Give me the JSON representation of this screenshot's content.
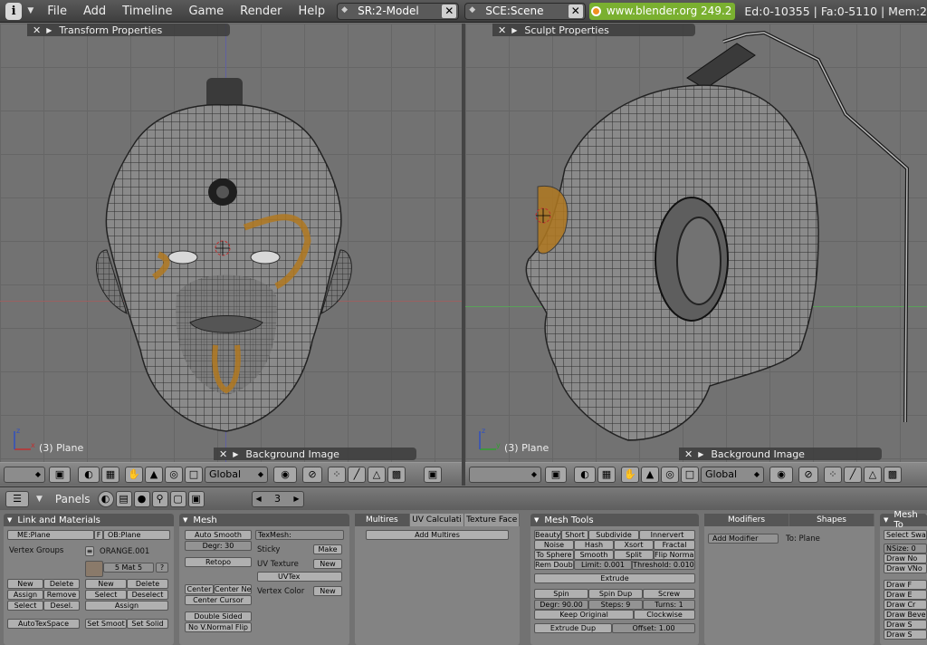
{
  "menu": {
    "items": [
      "File",
      "Add",
      "Timeline",
      "Game",
      "Render",
      "Help"
    ],
    "screen": "SR:2-Model",
    "scene": "SCE:Scene",
    "url": "www.blender.org 249.2",
    "stats": "Ed:0-10355 | Fa:0-5110 | Mem:2"
  },
  "left_view": {
    "panel_top": "Transform Properties",
    "panel_bottom": "Background Image",
    "object_label": "(3) Plane",
    "orientation": "Global"
  },
  "right_view": {
    "panel_top": "Sculpt Properties",
    "panel_bottom": "Background Image",
    "object_label": "(3) Plane",
    "orientation": "Global"
  },
  "buttons_header": {
    "label": "Panels",
    "frame": "3"
  },
  "link_materials": {
    "title": "Link and Materials",
    "mesh_name": "ME:Plane",
    "f_label": "F",
    "object_name": "OB:Plane",
    "vertex_groups": "Vertex Groups",
    "material": "ORANGE.001",
    "mat_index": "5 Mat 5",
    "q": "?",
    "vg_new": "New",
    "vg_delete": "Delete",
    "vg_assign": "Assign",
    "vg_remove": "Remove",
    "vg_select": "Select",
    "vg_desel": "Desel.",
    "m_new": "New",
    "m_delete": "Delete",
    "m_select": "Select",
    "m_deselect": "Deselect",
    "m_assign": "Assign",
    "autotex": "AutoTexSpace",
    "set_smooth": "Set Smoot",
    "set_solid": "Set Solid"
  },
  "mesh": {
    "title": "Mesh",
    "auto_smooth": "Auto Smooth",
    "degr": "Degr: 30",
    "retopo": "Retopo",
    "center": "Center",
    "center_new": "Center New",
    "center_cursor": "Center Cursor",
    "double_sided": "Double Sided",
    "no_vnormal": "No V.Normal Flip",
    "texmesh": "TexMesh:",
    "sticky": "Sticky",
    "make": "Make",
    "uv_texture": "UV Texture",
    "new1": "New",
    "uvtex": "UVTex",
    "vertex_color": "Vertex Color",
    "new2": "New"
  },
  "multires": {
    "tabs": [
      "Multires",
      "UV Calculati",
      "Texture Face"
    ],
    "add_multires": "Add Multires"
  },
  "mesh_tools": {
    "title": "Mesh Tools",
    "row1": [
      "Beauty",
      "Short",
      "Subdivide",
      "Innervert"
    ],
    "row2": [
      "Noise",
      "Hash",
      "Xsort",
      "Fractal"
    ],
    "row3": [
      "To Sphere",
      "Smooth",
      "Split",
      "Flip Normal"
    ],
    "rem_doubles": "Rem Doubl",
    "limit": "Limit: 0.001",
    "threshold": "Threshold: 0.010",
    "extrude": "Extrude",
    "spin": "Spin",
    "spin_dup": "Spin Dup",
    "screw": "Screw",
    "degr": "Degr: 90.00",
    "steps": "Steps: 9",
    "turns": "Turns: 1",
    "keep_original": "Keep Original",
    "clockwise": "Clockwise",
    "extrude_dup": "Extrude Dup",
    "offset": "Offset: 1.00"
  },
  "modifiers": {
    "tabs": [
      "Modifiers",
      "Shapes"
    ],
    "add_modifier": "Add Modifier",
    "to": "To: Plane"
  },
  "mesh_tools_more": {
    "title": "Mesh To",
    "select_swap": "Select Swa",
    "nsize": "NSize: 0",
    "draw_no": "Draw No",
    "draw_vn": "Draw VNo",
    "draw_f": "Draw F",
    "draw_e": "Draw E",
    "draw_cr": "Draw Cr",
    "draw_bevel": "Draw Bevel",
    "draw_s": "Draw S",
    "draw_s2": "Draw S"
  }
}
